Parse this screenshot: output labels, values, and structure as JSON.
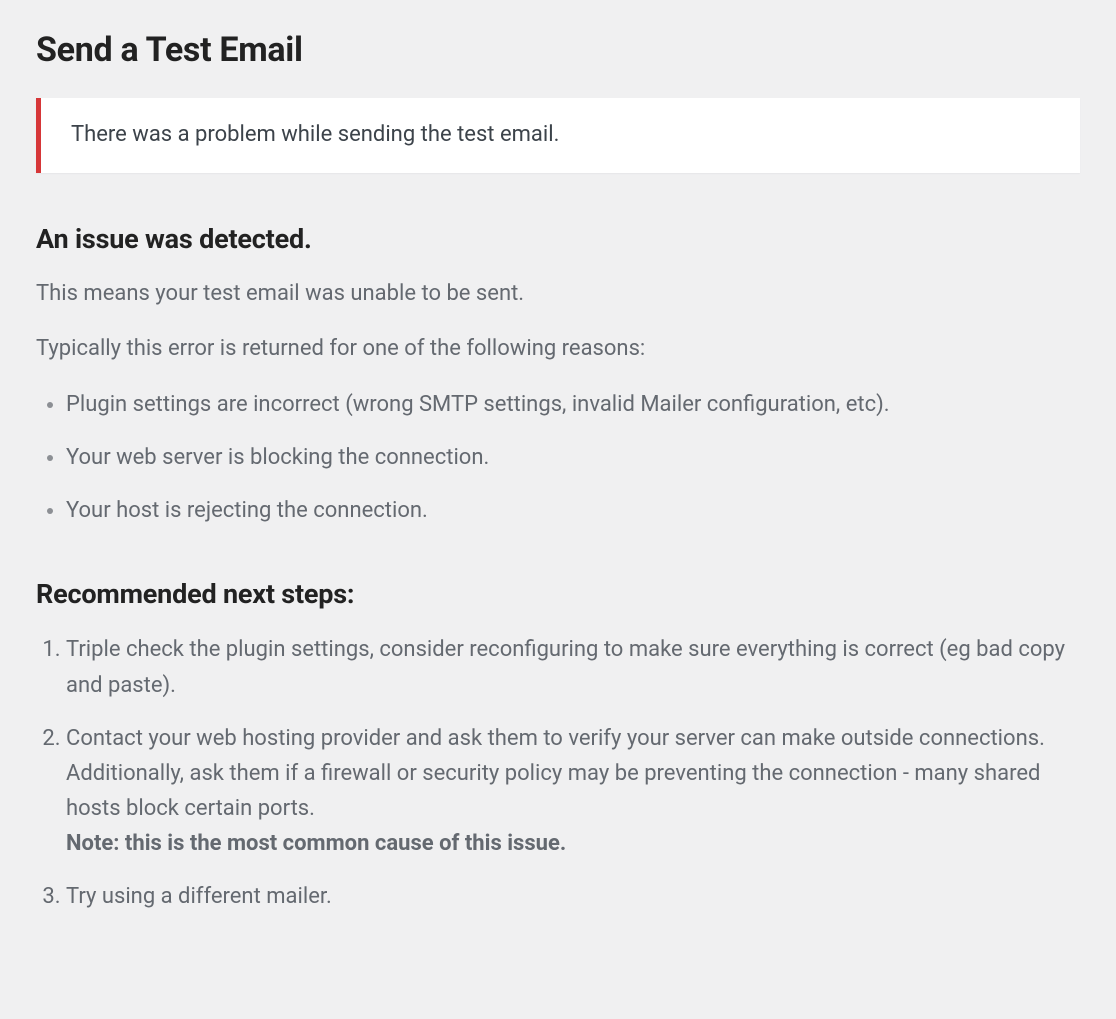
{
  "page_title": "Send a Test Email",
  "alert": {
    "message": "There was a problem while sending the test email."
  },
  "issue": {
    "heading": "An issue was detected.",
    "intro": "This means your test email was unable to be sent.",
    "reasons_intro": "Typically this error is returned for one of the following reasons:",
    "reasons": [
      "Plugin settings are incorrect (wrong SMTP settings, invalid Mailer configuration, etc).",
      "Your web server is blocking the connection.",
      "Your host is rejecting the connection."
    ]
  },
  "next_steps": {
    "heading": "Recommended next steps:",
    "steps": [
      {
        "text": "Triple check the plugin settings, consider reconfiguring to make sure everything is correct (eg bad copy and paste).",
        "note": ""
      },
      {
        "text": "Contact your web hosting provider and ask them to verify your server can make outside connections. Additionally, ask them if a firewall or security policy may be preventing the connection - many shared hosts block certain ports.",
        "note": "Note: this is the most common cause of this issue."
      },
      {
        "text": "Try using a different mailer.",
        "note": ""
      }
    ]
  }
}
